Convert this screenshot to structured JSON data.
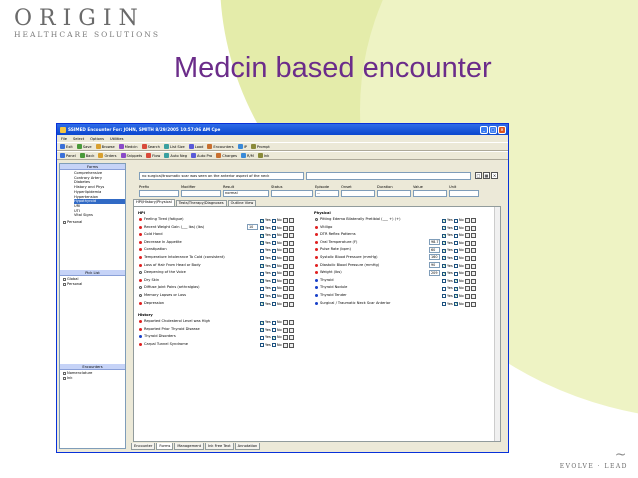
{
  "slide": {
    "logo_main": "ORIGIN",
    "logo_sub": "HEALTHCARE SOLUTIONS",
    "title": "Medcin based encounter",
    "brand_bottom_right": "EVOLVE · LEAD"
  },
  "window": {
    "title": "SSIMED Encounter For: JOHN, SMITH 8/29/2005 10:57:06 AM Cpe",
    "menu": [
      "File",
      "Select",
      "Options",
      "Utilities"
    ],
    "toolbar1": [
      "Exit",
      "Save",
      "Browse",
      "Medcin",
      "Search",
      "List Size",
      "Load",
      "Encounters",
      "IP",
      "Prompt"
    ],
    "toolbar2": [
      "Panel",
      "Back",
      "Orders",
      "Snippets",
      "Flow",
      "Auto Neg",
      "Auto Pro",
      "Charges",
      "R/M",
      "Ink"
    ]
  },
  "left_panel": {
    "forms_header": "Forms",
    "forms": [
      "Comprehensive",
      "Contrary Artery",
      "Diabetes",
      "History and Phys",
      "Hyperlipidemia",
      "Hypertension",
      "Hypothyroid",
      "URI",
      "UTI",
      "Vital Signs"
    ],
    "forms_selected": "Hypothyroid",
    "forms_tree": [
      "Personal"
    ],
    "picklist_header": "Pick List",
    "picklist": [
      "Global",
      "Personal"
    ],
    "encounters_header": "Encounters",
    "encounters": [
      "Nomenclature",
      "Ink"
    ]
  },
  "main": {
    "top_input": "no surgical/traumatic scar was seen on the anterior aspect of the neck",
    "field_headers": [
      "Prefix",
      "Modifier",
      "Result",
      "Status",
      "Episode",
      "Onset",
      "Duration",
      "Value",
      "Unit"
    ],
    "result_value": "normal",
    "episode_value": "...",
    "tabs": [
      "HPI/History/Physical",
      "Tests/Therapy/Diagnoses",
      "Outline View"
    ],
    "yes_label": "Yes",
    "no_label": "No",
    "hpi": {
      "heading": "HPI",
      "rows": [
        {
          "label": "Feeling Tired (fatigue)",
          "dot": "red",
          "yes": true,
          "no": false,
          "value": ""
        },
        {
          "label": "Recent Weight Gain (___ lbs) (lbs)",
          "dot": "red",
          "yes": true,
          "no": false,
          "value": "10"
        },
        {
          "label": "Cold Hand",
          "dot": "red",
          "yes": true,
          "no": false,
          "value": ""
        },
        {
          "label": "Decrease In Appetite",
          "dot": "red",
          "yes": true,
          "no": false,
          "value": ""
        },
        {
          "label": "Constipation",
          "dot": "red",
          "yes": false,
          "no": false,
          "value": ""
        },
        {
          "label": "Temperature Intolerance To Cold  (consistent)",
          "dot": "red",
          "yes": false,
          "no": false,
          "value": ""
        },
        {
          "label": "Loss of Hair From Head or Body",
          "dot": "red",
          "yes": true,
          "no": false,
          "value": ""
        },
        {
          "label": "Deepening of the Voice",
          "dot": "hollow",
          "yes": false,
          "no": false,
          "value": ""
        },
        {
          "label": "Dry Skin",
          "dot": "red",
          "yes": true,
          "no": false,
          "value": ""
        },
        {
          "label": "Diffuse Joint Pains (arthralgias)",
          "dot": "hollow",
          "yes": false,
          "no": false,
          "value": ""
        },
        {
          "label": "Memory Lapses or Loss",
          "dot": "hollow",
          "yes": false,
          "no": false,
          "value": ""
        },
        {
          "label": "Depression",
          "dot": "red",
          "yes": true,
          "no": false,
          "value": ""
        }
      ]
    },
    "history": {
      "heading": "History",
      "rows": [
        {
          "label": "Reported Cholesterol Level was High",
          "dot": "red",
          "yes": true,
          "no": false
        },
        {
          "label": "Reported Prior Thyroid Disease",
          "dot": "red",
          "yes": true,
          "no": false
        },
        {
          "label": "Thyroid Disorders",
          "dot": "blue",
          "yes": false,
          "no": true
        },
        {
          "label": "Carpal Tunnel Syndrome",
          "dot": "red",
          "yes": false,
          "no": false
        }
      ]
    },
    "physical": {
      "heading": "Physical",
      "rows": [
        {
          "label": "Pitting Edema Bilaterally Pretibial (___ +) (+)",
          "dot": "hollow",
          "yes": true,
          "no": false,
          "value": ""
        },
        {
          "label": "Vitiligo",
          "dot": "red",
          "yes": true,
          "no": false,
          "value": ""
        },
        {
          "label": "DTR Reflex Patterns",
          "dot": "red",
          "yes": true,
          "no": false,
          "value": ""
        },
        {
          "label": "Oral Temperature (F)",
          "dot": "red",
          "yes": true,
          "no": false,
          "value": "98.7"
        },
        {
          "label": "Pulse Rate (bpm)",
          "dot": "red",
          "yes": true,
          "no": false,
          "value": "60"
        },
        {
          "label": "Systolic Blood Pressure (mmHg)",
          "dot": "red",
          "yes": true,
          "no": false,
          "value": "160"
        },
        {
          "label": "Diastolic Blood Pressure (mmHg)",
          "dot": "red",
          "yes": true,
          "no": false,
          "value": "90"
        },
        {
          "label": "Weight (lbs)",
          "dot": "red",
          "yes": true,
          "no": false,
          "value": "209"
        },
        {
          "label": "Thyroid",
          "dot": "blue",
          "yes": false,
          "no": true,
          "value": ""
        },
        {
          "label": "Thyroid Nodule",
          "dot": "blue",
          "yes": false,
          "no": true,
          "value": ""
        },
        {
          "label": "Thyroid Tender",
          "dot": "blue",
          "yes": false,
          "no": true,
          "value": ""
        },
        {
          "label": "Surgical / Traumatic Neck Scar Anterior",
          "dot": "blue",
          "yes": false,
          "no": true,
          "value": ""
        }
      ]
    }
  },
  "bottom_tabs": [
    "Encounter",
    "Forms",
    "Management",
    "Ink Free Text",
    "Annotation"
  ],
  "bottom_tab_active": "Forms"
}
